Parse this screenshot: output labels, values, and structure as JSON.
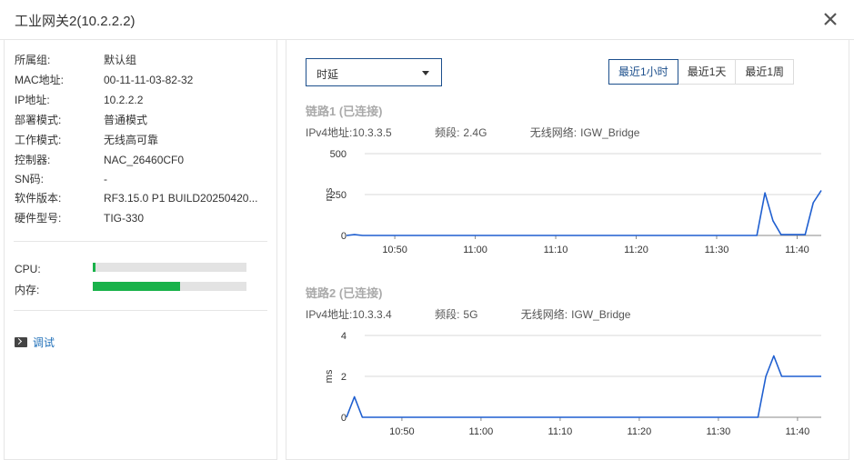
{
  "window": {
    "title": "工业网关2(10.2.2.2)"
  },
  "device": {
    "fields": [
      {
        "key": "所属组:",
        "value": "默认组"
      },
      {
        "key": "MAC地址:",
        "value": "00-11-11-03-82-32"
      },
      {
        "key": "IP地址:",
        "value": "10.2.2.2"
      },
      {
        "key": "部署模式:",
        "value": "普通模式"
      },
      {
        "key": "工作模式:",
        "value": "无线高可靠"
      },
      {
        "key": "控制器:",
        "value": "NAC_26460CF0"
      },
      {
        "key": "SN码:",
        "value": "-"
      },
      {
        "key": "软件版本:",
        "value": "RF3.15.0 P1 BUILD20250420..."
      },
      {
        "key": "硬件型号:",
        "value": "TIG-330"
      }
    ]
  },
  "resources": {
    "cpu": {
      "label": "CPU:",
      "usage": 0.02
    },
    "memory": {
      "label": "内存:",
      "usage": 0.57
    }
  },
  "debug": {
    "label": "调试"
  },
  "metric_select": {
    "value": "时延"
  },
  "time_range": {
    "options": [
      "最近1小时",
      "最近1天",
      "最近1周"
    ],
    "selected": 0
  },
  "links": [
    {
      "title": "链路1 (已连接)",
      "ipv4_label": "IPv4地址:",
      "ipv4": "10.3.3.5",
      "band_label": "频段:",
      "band": "2.4G",
      "ssid_label": "无线网络:",
      "ssid": "IGW_Bridge"
    },
    {
      "title": "链路2 (已连接)",
      "ipv4_label": "IPv4地址:",
      "ipv4": "10.3.3.4",
      "band_label": "频段:",
      "band": "5G",
      "ssid_label": "无线网络:",
      "ssid": "IGW_Bridge"
    }
  ],
  "colors": {
    "accent": "#1c4f8c",
    "line": "#1f5fd0",
    "cpu_bar": "#19b24a",
    "memory_bar": "#19b24a"
  },
  "chart_data": [
    {
      "type": "line",
      "ylabel": "ms",
      "ylim": [
        0,
        500
      ],
      "yticks": [
        "0",
        "250",
        "500"
      ],
      "xlim": [
        "10:44",
        "11:43"
      ],
      "xticks": [
        "10:50",
        "11:00",
        "11:10",
        "11:20",
        "11:30",
        "11:40"
      ],
      "series": [
        {
          "x": [
            "10:44",
            "10:45",
            "10:46",
            "11:35",
            "11:36",
            "11:37",
            "11:38",
            "11:39",
            "11:40",
            "11:41",
            "11:42",
            "11:43"
          ],
          "y": [
            0,
            5,
            0,
            0,
            260,
            90,
            5,
            5,
            5,
            5,
            200,
            275
          ]
        }
      ]
    },
    {
      "type": "line",
      "ylabel": "ms",
      "ylim": [
        0,
        4
      ],
      "yticks": [
        "0",
        "2",
        "4"
      ],
      "xlim": [
        "10:43",
        "11:43"
      ],
      "xticks": [
        "10:50",
        "11:00",
        "11:10",
        "11:20",
        "11:30",
        "11:40"
      ],
      "series": [
        {
          "x": [
            "10:43",
            "10:44",
            "10:45",
            "11:35",
            "11:36",
            "11:37",
            "11:38",
            "11:43"
          ],
          "y": [
            0,
            1,
            0,
            0,
            2,
            3,
            2,
            2
          ]
        }
      ]
    }
  ]
}
